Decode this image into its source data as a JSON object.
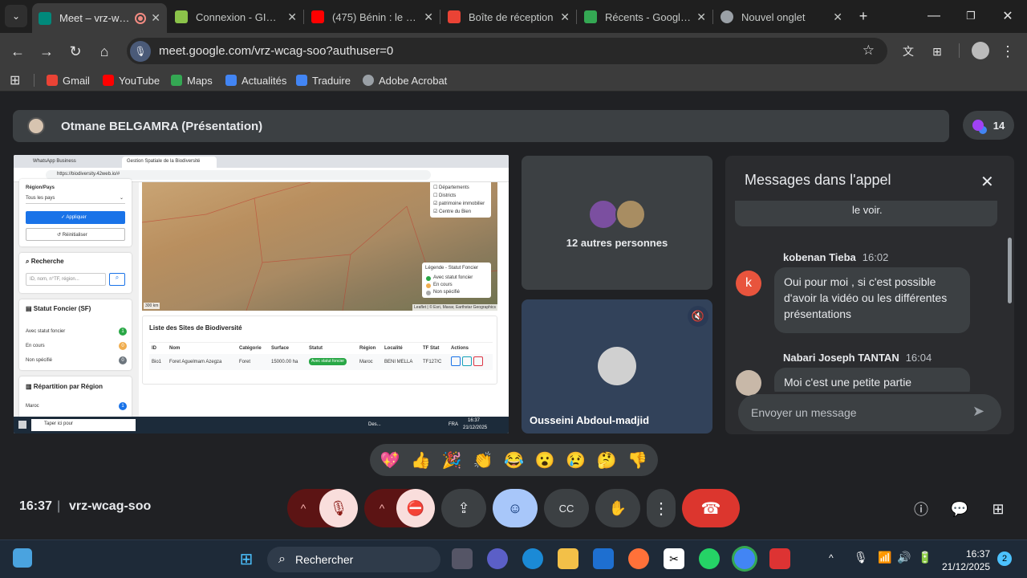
{
  "browser": {
    "tabs": [
      {
        "title": "Meet – vrz-wcag-soo",
        "favcolor": "#00897b",
        "active": true
      },
      {
        "title": "Connexion - GIS Digital",
        "favcolor": "#8bc34a",
        "active": false
      },
      {
        "title": "(475) Bénin : le Collectif",
        "favcolor": "#ff0000",
        "active": false
      },
      {
        "title": "Boîte de réception",
        "favcolor": "#ea4335",
        "active": false
      },
      {
        "title": "Récents - Google Drive",
        "favcolor": "#34a853",
        "active": false
      },
      {
        "title": "Nouvel onglet",
        "favcolor": "#9aa0a6",
        "active": false
      }
    ],
    "url": "meet.google.com/vrz-wcag-soo?authuser=0",
    "bookmarks": [
      {
        "label": "Gmail",
        "color": "#ea4335"
      },
      {
        "label": "YouTube",
        "color": "#ff0000"
      },
      {
        "label": "Maps",
        "color": "#34a853"
      },
      {
        "label": "Actualités",
        "color": "#4285f4"
      },
      {
        "label": "Traduire",
        "color": "#4285f4"
      },
      {
        "label": "Adobe Acrobat",
        "color": "#9aa0a6"
      }
    ]
  },
  "meet": {
    "presenter": "Otmane BELGAMRA (Présentation)",
    "participant_count": "14",
    "others_label": "12 autres personnes",
    "tile_name": "Ousseini Abdoul-madjid",
    "shared_screen": {
      "tab1": "WhatsApp Business",
      "tab2": "Gestion Spatiale de la Biodiversité",
      "url": "https://biodiversity.42web.io/#",
      "region_label": "Région/Pays",
      "region_value": "Tous les pays",
      "apply_btn": "✓ Appliquer",
      "reset_btn": "↺ Réinitialiser",
      "search_title": "Recherche",
      "search_placeholder": "ID, nom, n°TF, région...",
      "statut_title": "Statut Foncier (SF)",
      "statut_rows": [
        {
          "label": "Avec statut foncier",
          "count": "1",
          "color": "#28a745"
        },
        {
          "label": "En cours",
          "count": "0",
          "color": "#f0ad4e"
        },
        {
          "label": "Non spécifié",
          "count": "0",
          "color": "#6c757d"
        }
      ],
      "repartition_title": "Répartition par Région",
      "repartition_first": "Maroc",
      "repartition_first_count": "1",
      "layers": [
        "Départements",
        "Districts",
        "patrimoine immobilier",
        "Centre du Bien"
      ],
      "legend_title": "Légende - Statut Foncier",
      "legend_items": [
        {
          "label": "Avec statut foncier",
          "color": "#28a745"
        },
        {
          "label": "En cours",
          "color": "#f0ad4e"
        },
        {
          "label": "Non spécifié",
          "color": "#aaaaaa"
        }
      ],
      "scale": "300 km",
      "attribution": "Leaflet | © Esri, Maxar, Earthstar Geographics",
      "table_title": "Liste des Sites de Biodiversité",
      "table_headers": [
        "ID",
        "Nom",
        "Catégorie",
        "Surface",
        "Statut",
        "Région",
        "Localité",
        "TF Stat",
        "Actions"
      ],
      "table_row": [
        "Bio1",
        "Foret Aguelmam Azegza",
        "Foret",
        "15000.00 ha",
        "Avec statut foncier",
        "Maroc",
        "BENI MELLA",
        "TF127/C"
      ],
      "taskbar_search": "Taper ici pour",
      "taskbar_time": "16:37",
      "taskbar_date": "21/12/2025",
      "taskbar_lang": "FRA",
      "taskbar_des": "Des..."
    },
    "chat": {
      "title": "Messages dans l'appel",
      "prev_text": "le voir.",
      "messages": [
        {
          "sender": "kobenan Tieba",
          "time": "16:02",
          "initial": "k",
          "text": "Oui pour moi , si c'est possible d'avoir la vidéo ou les différentes présentations"
        },
        {
          "sender": "Nabari Joseph TANTAN",
          "time": "16:04",
          "initial": "",
          "text": "Moi c'est une petite partie"
        }
      ],
      "input_placeholder": "Envoyer un message"
    },
    "reactions": [
      "💖",
      "👍",
      "🎉",
      "👏",
      "😂",
      "😮",
      "😢",
      "🤔",
      "👎"
    ],
    "clock": "16:37",
    "separator": "|",
    "meeting_code": "vrz-wcag-soo"
  },
  "taskbar": {
    "search_label": "Rechercher",
    "time": "16:37",
    "date": "21/12/2025",
    "notif_count": "2"
  }
}
